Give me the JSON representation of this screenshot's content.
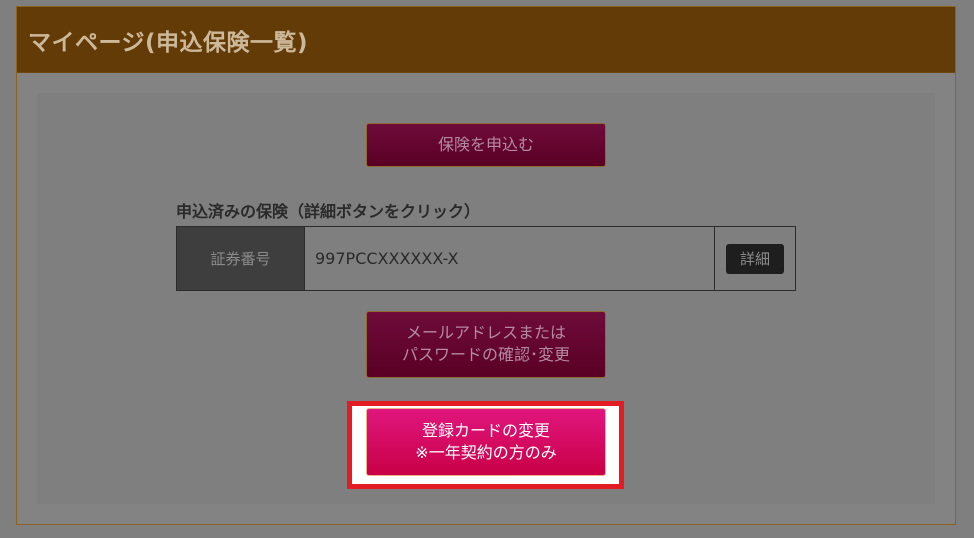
{
  "header": {
    "title": "マイページ(申込保険一覧)"
  },
  "actions": {
    "apply_label": "保険を申込む"
  },
  "applied_section": {
    "label": "申込済みの保険（詳細ボタンをクリック）",
    "policy_number_header": "証券番号",
    "policy_number": "997PCCXXXXXX-X",
    "detail_button": "詳細"
  },
  "account": {
    "email_button_line1": "メールアドレスまたは",
    "email_button_line2": "パスワードの確認･変更"
  },
  "card": {
    "button_line1": "登録カードの変更",
    "button_line2": "※一年契約の方のみ"
  },
  "colors": {
    "header_bg": "#633b07",
    "primary_button": "#6e0b3a",
    "highlight_button": "#e0167e",
    "highlight_border": "#e31b23"
  }
}
